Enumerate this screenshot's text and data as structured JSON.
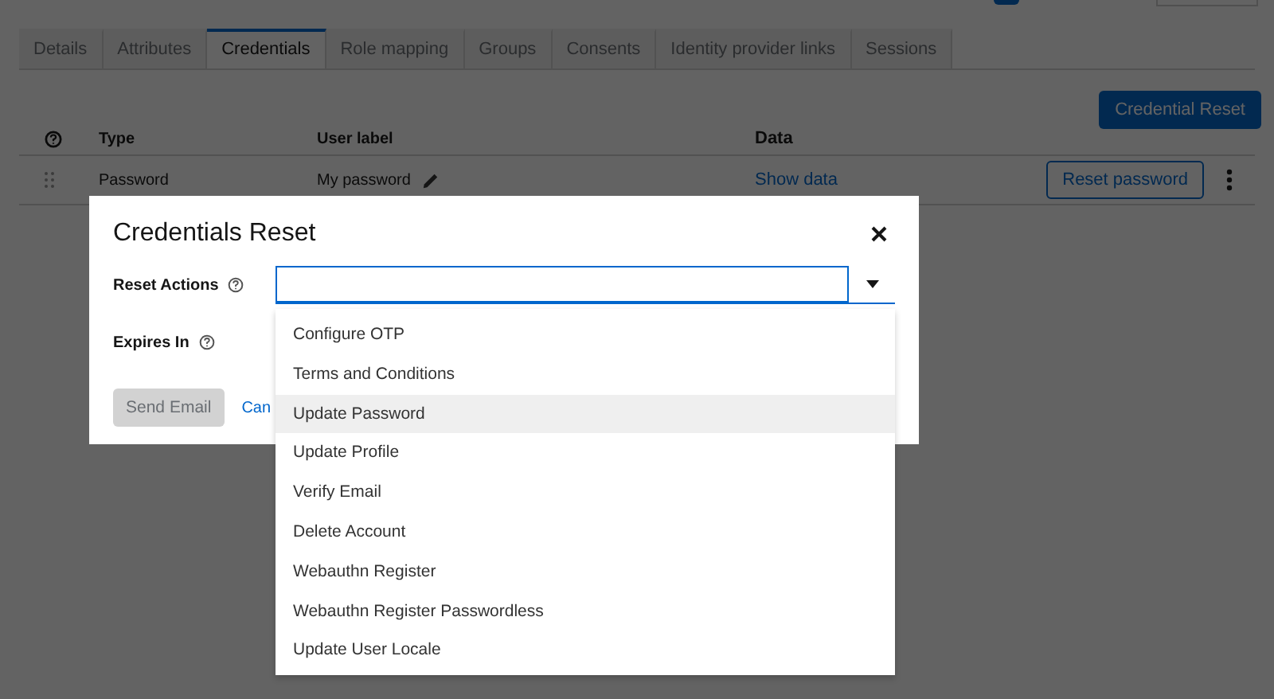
{
  "tabs": [
    {
      "label": "Details",
      "selected": false
    },
    {
      "label": "Attributes",
      "selected": false
    },
    {
      "label": "Credentials",
      "selected": true
    },
    {
      "label": "Role mapping",
      "selected": false
    },
    {
      "label": "Groups",
      "selected": false
    },
    {
      "label": "Consents",
      "selected": false
    },
    {
      "label": "Identity provider links",
      "selected": false
    },
    {
      "label": "Sessions",
      "selected": false
    }
  ],
  "credential_reset_button": "Credential Reset",
  "table": {
    "columns": [
      "Type",
      "User label",
      "Data"
    ],
    "rows": [
      {
        "type": "Password",
        "user_label": "My password",
        "data_link": "Show data",
        "action": "Reset password"
      }
    ]
  },
  "dialog": {
    "title": "Credentials Reset",
    "reset_actions": {
      "label": "Reset Actions",
      "options": [
        {
          "label": "Configure OTP",
          "selected": false
        },
        {
          "label": "Terms and Conditions",
          "selected": false
        },
        {
          "label": "Update Password",
          "selected": true
        },
        {
          "label": "Update Profile",
          "selected": false
        },
        {
          "label": "Verify Email",
          "selected": false
        },
        {
          "label": "Delete Account",
          "selected": false
        },
        {
          "label": "Webauthn Register",
          "selected": false
        },
        {
          "label": "Webauthn Register Passwordless",
          "selected": false
        },
        {
          "label": "Update User Locale",
          "selected": false
        }
      ]
    },
    "expires_in": {
      "label": "Expires In"
    },
    "send_button": {
      "label": "Send Email",
      "disabled": true
    },
    "cancel_link": "Can"
  }
}
